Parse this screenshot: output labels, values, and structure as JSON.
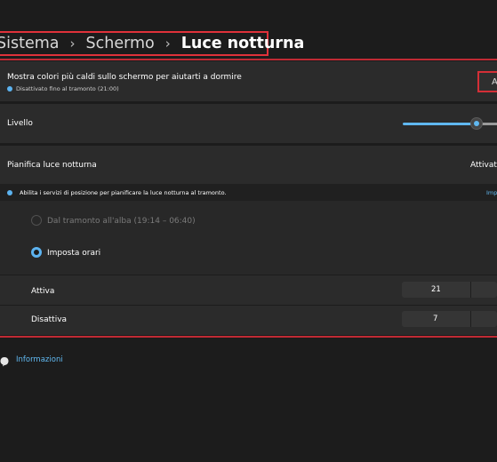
{
  "breadcrumb": {
    "items": [
      "Sistema",
      "Schermo",
      "Luce notturna"
    ]
  },
  "night_light": {
    "title": "Mostra colori più caldi sullo schermo per aiutarti a dormire",
    "status": "Disattivato fino al tramonto (21:00)",
    "button_label": "A"
  },
  "level": {
    "label": "Livello",
    "value_fraction": 0.75
  },
  "schedule": {
    "label": "Pianifica luce notturna",
    "toggle_state": "Attivato",
    "location_notice": "Abilita i servizi di posizione per pianificare la luce notturna al tramonto.",
    "location_link": "Imp",
    "options": [
      {
        "label": "Dal tramonto all'alba (19:14 – 06:40)",
        "selected": false,
        "disabled": true
      },
      {
        "label": "Imposta orari",
        "selected": true,
        "disabled": false
      }
    ],
    "on": {
      "label": "Attiva",
      "hour": "21"
    },
    "off": {
      "label": "Disattiva",
      "hour": "7"
    }
  },
  "footer": {
    "info_label": "Informazioni"
  },
  "colors": {
    "accent": "#5cb3f0",
    "highlight_border": "#e0313a",
    "background": "#1c1c1c",
    "card": "#2b2b2b"
  }
}
